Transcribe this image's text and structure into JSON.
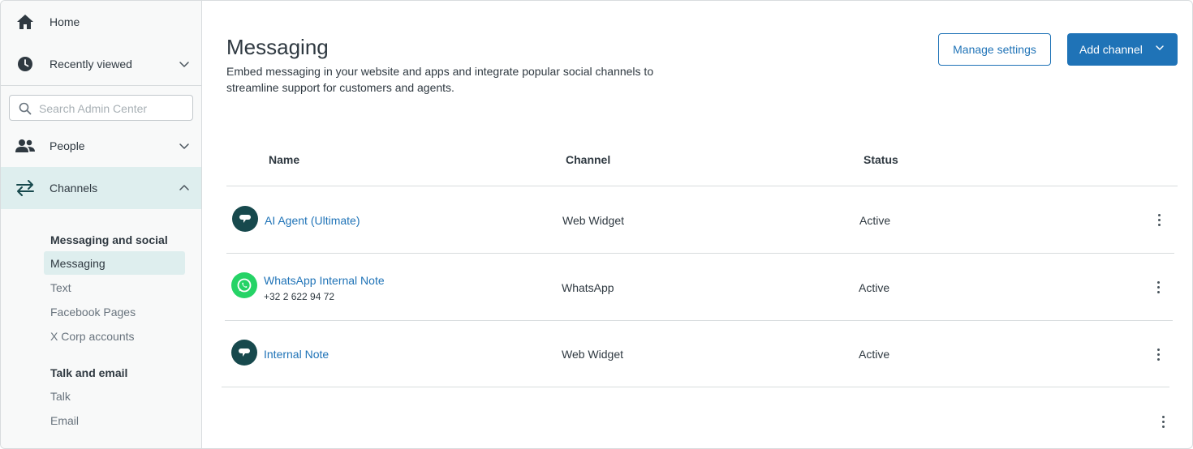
{
  "sidebar": {
    "home_label": "Home",
    "recent_label": "Recently viewed",
    "search_placeholder": "Search Admin Center",
    "people_label": "People",
    "channels_label": "Channels",
    "sections": [
      {
        "heading": "Messaging and social",
        "items": [
          "Messaging",
          "Text",
          "Facebook Pages",
          "X Corp accounts"
        ]
      },
      {
        "heading": "Talk and email",
        "items": [
          "Talk",
          "Email"
        ]
      }
    ],
    "selected_item": "Messaging"
  },
  "page": {
    "title": "Messaging",
    "description": "Embed messaging in your website and apps and integrate popular social channels to streamline support for customers and agents.",
    "manage_settings_label": "Manage settings",
    "add_channel_label": "Add channel"
  },
  "table": {
    "columns": [
      "Name",
      "Channel",
      "Status"
    ],
    "rows": [
      {
        "name": "AI Agent (Ultimate)",
        "subtitle": "",
        "channel": "Web Widget",
        "status": "Active",
        "icon": "chat-bubble-icon"
      },
      {
        "name": "WhatsApp Internal Note",
        "subtitle": "+32 2 622 94 72",
        "channel": "WhatsApp",
        "status": "Active",
        "icon": "whatsapp-icon"
      },
      {
        "name": "Internal Note",
        "subtitle": "",
        "channel": "Web Widget",
        "status": "Active",
        "icon": "chat-bubble-icon"
      }
    ]
  },
  "colors": {
    "accent": "#1f73b7",
    "sidebar_bg": "#f8f9f9",
    "active_bg": "#deeeee",
    "avatar_dark": "#17494d",
    "whatsapp_green": "#25d366"
  }
}
